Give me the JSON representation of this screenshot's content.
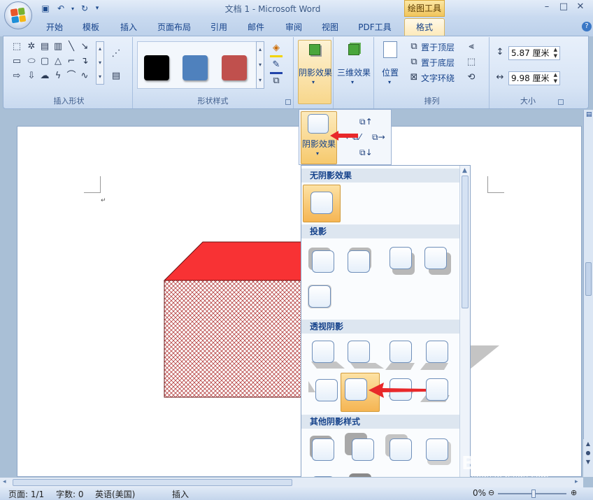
{
  "window": {
    "title": "文档 1 - Microsoft Word",
    "context_tab_group": "绘图工具",
    "controls": [
      "–",
      "□",
      "✕"
    ]
  },
  "tabs": [
    "开始",
    "模板",
    "插入",
    "页面布局",
    "引用",
    "邮件",
    "审阅",
    "视图",
    "PDF工具",
    "格式"
  ],
  "ribbon": {
    "insert_shapes_label": "插入形状",
    "shape_styles_label": "形状样式",
    "shadow_effect_label": "阴影效果",
    "threed_effect_label": "三维效果",
    "position_label": "位置",
    "bring_front": "置于顶层",
    "send_back": "置于底层",
    "text_wrap": "文字环绕",
    "arrange_label": "排列",
    "size_label": "大小",
    "height_value": "5.87 厘米",
    "width_value": "9.98 厘米",
    "swatch_colors": [
      "#000000",
      "#4f81bd",
      "#c0504d"
    ]
  },
  "popup": {
    "shadow_effect_label": "阴影效果"
  },
  "gallery": {
    "sections": [
      "无阴影效果",
      "投影",
      "透视阴影",
      "其他阴影样式"
    ]
  },
  "status": {
    "page": "页面: 1/1",
    "words": "字数: 0",
    "language": "英语(美国)",
    "mode": "插入",
    "zoom": "0%"
  },
  "watermark": {
    "brand": "Baidu经验",
    "url": "jingyan.baidu.com"
  },
  "colors": {
    "accent_red": "#e8282a",
    "shape_top": "#f83234",
    "highlight_orange": "#f9c66a"
  }
}
